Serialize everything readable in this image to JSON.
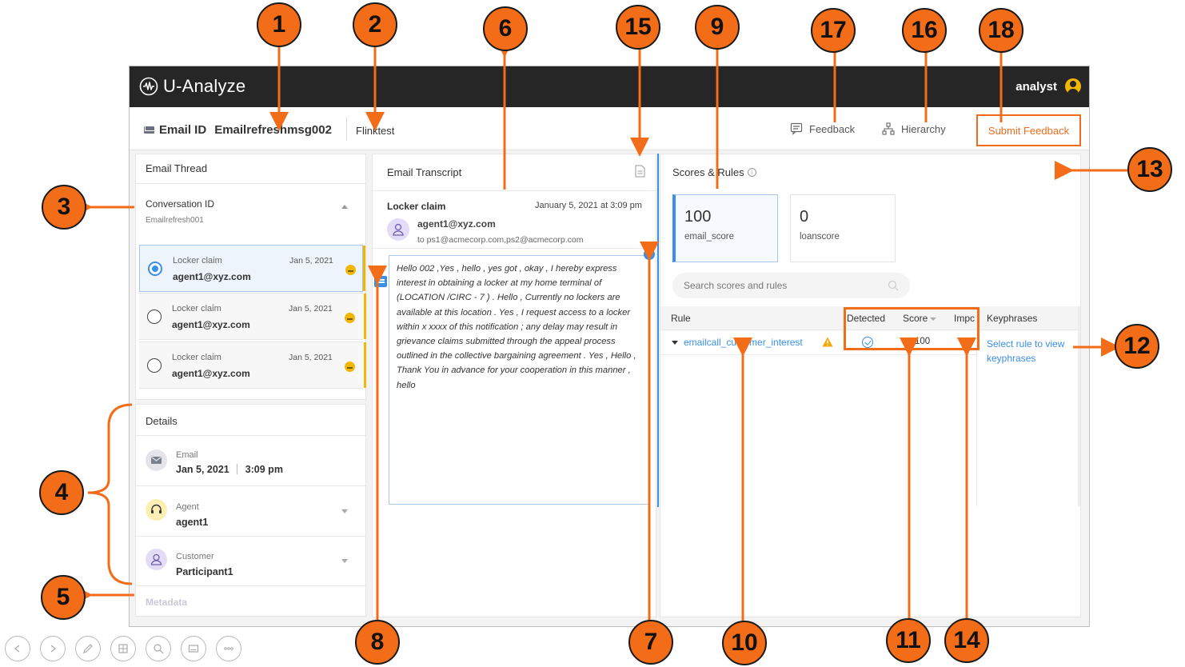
{
  "app": {
    "logo_text": "U-Analyze",
    "user_name": "analyst"
  },
  "subheader": {
    "email_id_label": "Email ID",
    "email_id_value": "Emailrefreshmsg002",
    "tenant": "Flinktest",
    "feedback_label": "Feedback",
    "hierarchy_label": "Hierarchy",
    "submit_label": "Submit Feedback"
  },
  "thread": {
    "title": "Email Thread",
    "conversation_label": "Conversation ID",
    "conversation_value": "Emailrefresh001",
    "items": [
      {
        "subject": "Locker claim",
        "date": "Jan 5, 2021",
        "sender": "agent1@xyz.com",
        "selected": true
      },
      {
        "subject": "Locker claim",
        "date": "Jan 5, 2021",
        "sender": "agent1@xyz.com",
        "selected": false
      },
      {
        "subject": "Locker claim",
        "date": "Jan 5, 2021",
        "sender": "agent1@xyz.com",
        "selected": false
      }
    ]
  },
  "details": {
    "title": "Details",
    "email_label": "Email",
    "email_date": "Jan 5, 2021",
    "email_time": "3:09 pm",
    "agent_label": "Agent",
    "agent_value": "agent1",
    "customer_label": "Customer",
    "customer_value": "Participant1",
    "metadata_label": "Metadata"
  },
  "transcript": {
    "title": "Email Transcript",
    "subject": "Locker claim",
    "date": "January 5, 2021 at 3:09 pm",
    "from": "agent1@xyz.com",
    "to": "to ps1@acmecorp.com,ps2@acmecorp.com",
    "body": "Hello 002 ,Yes , hello , yes got , okay , I hereby express interest in obtaining a locker at my home terminal of (LOCATION /CIRC - 7 ) . Hello , Currently no lockers are available at this location . Yes , I request access to a locker within x xxxx of this notification ; any delay may result in grievance claims submitted through the appeal process outlined in the collective bargaining agreement . Yes , Hello , Thank You in advance for your cooperation in this manner , hello",
    "plus": "+"
  },
  "scores": {
    "title": "Scores & Rules",
    "info": "i",
    "cards": [
      {
        "value": "100",
        "name": "email_score"
      },
      {
        "value": "0",
        "name": "loanscore"
      }
    ],
    "search_placeholder": "Search scores and rules",
    "columns": {
      "rule": "Rule",
      "detected": "Detected",
      "score": "Score",
      "impact": "Impc",
      "keyphrases": "Keyphrases"
    },
    "rule_name": "emailcall_customer_interest",
    "rule_score": "100",
    "rule_impact": "+",
    "keyphrases_hint": "Select rule to view keyphrases"
  },
  "callouts": [
    "1",
    "2",
    "3",
    "4",
    "5",
    "6",
    "7",
    "8",
    "9",
    "10",
    "11",
    "12",
    "13",
    "14",
    "15",
    "16",
    "17",
    "18"
  ],
  "colors": {
    "accent": "#f36c18",
    "link": "#3a8fe8",
    "topbar": "#262626",
    "warning": "#f2b705"
  },
  "nav_icons": [
    "prev-icon",
    "next-icon",
    "pen-icon",
    "slides-icon",
    "zoom-icon",
    "subtitles-icon",
    "more-icon"
  ]
}
